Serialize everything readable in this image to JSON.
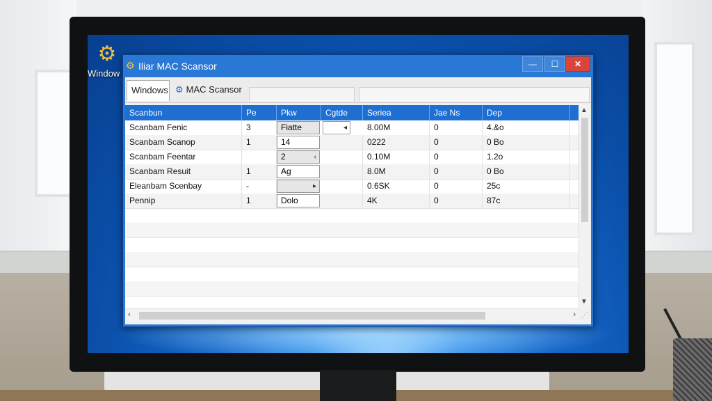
{
  "desktop": {
    "icon_label": "Window"
  },
  "app": {
    "title": "Iliar MAC Scansor",
    "controls": {
      "minimize": "—",
      "maximize": "☐",
      "close": "✕"
    },
    "tabs": [
      {
        "label": "Windows"
      },
      {
        "label": "MAC Scansor"
      }
    ]
  },
  "table": {
    "columns": [
      "Scanbun",
      "Pe",
      "Pkw",
      "Cgtde",
      "Seriea",
      "Jae Ns",
      "Dep"
    ],
    "rows": [
      [
        "Scanbam Fenic",
        "3",
        "Fiatte",
        "",
        "8.00M",
        "0",
        "4.&o"
      ],
      [
        "Scanbam Scanop",
        "1",
        "14",
        "",
        "0222",
        "0",
        "0 Bo"
      ],
      [
        "Scanbam Feentar",
        "",
        "2",
        "",
        "0.10M",
        "0",
        "1.2o"
      ],
      [
        "Scanbam Resuit",
        "1",
        "Ag",
        "",
        "8.0M",
        "0",
        "0 Bo"
      ],
      [
        "Eleanbam Scenbay",
        "-",
        "",
        "",
        "0.6SK",
        "0",
        "25c"
      ],
      [
        "Pennip",
        "1",
        "Dolo",
        "",
        "4K",
        "0",
        "87c"
      ]
    ]
  },
  "icons": [
    "app-gear-icon",
    "tab-scanner-icon",
    "dropdown-arrow-icon",
    "scroll-arrow-icon",
    "resize-grip-icon"
  ],
  "colors": {
    "header": "#1f6fd2",
    "titlebar": "#2a78d6",
    "close": "#d9453a"
  }
}
